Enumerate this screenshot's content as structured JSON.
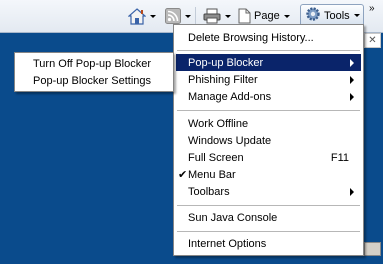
{
  "toolbar": {
    "home_icon": "home-icon",
    "feeds_icon": "feeds-icon",
    "print_icon": "print-icon",
    "page_label": "Page",
    "tools_label": "Tools",
    "overflow_label": "»"
  },
  "tools_menu": {
    "items": [
      {
        "label": "Delete Browsing History..."
      },
      {
        "label": "Pop-up Blocker",
        "submenu": true,
        "highlighted": true
      },
      {
        "label": "Phishing Filter",
        "submenu": true
      },
      {
        "label": "Manage Add-ons",
        "submenu": true
      },
      {
        "label": "Work Offline"
      },
      {
        "label": "Windows Update"
      },
      {
        "label": "Full Screen",
        "shortcut": "F11"
      },
      {
        "label": "Menu Bar",
        "checked": true
      },
      {
        "label": "Toolbars",
        "submenu": true
      },
      {
        "label": "Sun Java Console"
      },
      {
        "label": "Internet Options"
      }
    ],
    "check_glyph": "✔"
  },
  "popup_submenu": {
    "items": [
      {
        "label": "Turn Off Pop-up Blocker"
      },
      {
        "label": "Pop-up Blocker Settings"
      }
    ]
  },
  "colors": {
    "highlight": "#0a246a",
    "background": "#0a4b8c"
  }
}
